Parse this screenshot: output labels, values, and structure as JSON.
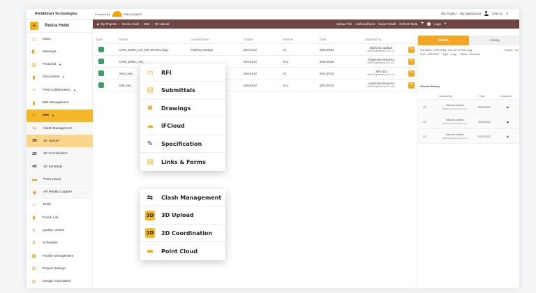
{
  "topbar": {
    "company": "iFieldSmart Technologies",
    "powered_by": "Powered By",
    "logo_text": "iFIELDSMART",
    "my_project": "My Project",
    "my_dashboard": "My Dashboard",
    "user": "John D."
  },
  "sidebar": {
    "project": "Revira Hotel",
    "items": [
      {
        "label": "Inbox",
        "icon": "inbox-icon"
      },
      {
        "label": "Meetings",
        "icon": "meetings-icon"
      },
      {
        "label": "Financial",
        "icon": "financial-icon",
        "dropdown": true
      },
      {
        "label": "Documents",
        "icon": "documents-icon",
        "dropdown": true
      },
      {
        "label": "Field Collaboration",
        "icon": "field-collaboration-icon",
        "dropdown": true
      },
      {
        "label": "BID Management",
        "icon": "bid-icon"
      },
      {
        "label": "BIM",
        "icon": "bim-icon",
        "dropdown": true
      },
      {
        "label": "Clash Management",
        "icon": "clash-icon"
      },
      {
        "label": "3D Upload",
        "icon": "3d-icon"
      },
      {
        "label": "2D Coordination",
        "icon": "2d-icon"
      },
      {
        "label": "4D Schedule",
        "icon": "4d-icon"
      },
      {
        "label": "Point Cloud",
        "icon": "point-cloud-icon"
      },
      {
        "label": "AR Reality Capture",
        "icon": "ar-icon"
      },
      {
        "label": "Tasks",
        "icon": "tasks-icon"
      },
      {
        "label": "Punch List",
        "icon": "punch-list-icon"
      },
      {
        "label": "Quality control",
        "icon": "quality-icon"
      },
      {
        "label": "Scheduler",
        "icon": "scheduler-icon"
      },
      {
        "label": "Facility Management",
        "icon": "facility-icon"
      },
      {
        "label": "Project Settings",
        "icon": "settings-icon"
      },
      {
        "label": "Design Automation",
        "icon": "automation-icon"
      }
    ]
  },
  "breadcrumb": {
    "items": [
      "My Projects",
      "Revira Hotel",
      "BIM",
      "3D Upload"
    ],
    "actions": [
      "Upload File",
      "Add level/area",
      "Export Clash",
      "Refresh Data",
      "Logs"
    ]
  },
  "table": {
    "headers": [
      "Type",
      "Name",
      "Levels/Areas",
      "Trades",
      "Version",
      "Date",
      "Updated by"
    ],
    "rows": [
      {
        "name": "UPM_BIMe_L04_DR SPOOL.dwg",
        "level": "Parking Garage",
        "trade": "Electrical",
        "version": "V1",
        "date": "8/01/2022",
        "by": "Mukund Jadhav",
        "co": "(BIM Engineering US LLC)"
      },
      {
        "name": "UPM_BIMe_L05_",
        "level": "",
        "trade": "Electrical",
        "version": "V12",
        "date": "8/01/2022",
        "by": "Anderson Stevens",
        "co": "(BIM Engineering US LLC)"
      },
      {
        "name": "WD1.nwc",
        "level": "",
        "trade": "Electrical",
        "version": "V1",
        "date": "8/01/2022",
        "by": "John Do",
        "co": "(BIM Engineering US LLC)"
      },
      {
        "name": "test.nwc",
        "level": "",
        "trade": "Electrical",
        "version": "V12",
        "date": "8/01/2022",
        "by": "Anderson Stevens",
        "co": "(BIM Engineering US LLC)"
      }
    ]
  },
  "details": {
    "tab_details": "Details",
    "tab_activity": "Activity",
    "file_name": "File Name : UPM_BIMe_L05_DR SPOOL.dwg",
    "version": "Version : V4",
    "date": "Date : 8/01/2022",
    "type": "Type : .Dwg",
    "status": "Status : Electrical",
    "history_title": "Version History",
    "history_headers": [
      "Updated By",
      "Date",
      "Download"
    ],
    "history": [
      {
        "v": "V3",
        "by": "Mukund Jadhav",
        "co": "(BIM Engineering US LLC)",
        "date": "02/01/2022"
      },
      {
        "v": "V2",
        "by": "Mukund Jadhav",
        "co": "(BIM Engineering US LLC)",
        "date": "02/01/2022"
      },
      {
        "v": "V1",
        "by": "Mukund Jadhav",
        "co": "(BIM Engineering US LLC)",
        "date": "02/01/2022"
      }
    ]
  },
  "menu1": {
    "items": [
      {
        "label": "RFI",
        "icon": "rfi-icon"
      },
      {
        "label": "Submittals",
        "icon": "submittals-icon"
      },
      {
        "label": "Drawings",
        "icon": "drawings-icon"
      },
      {
        "label": "iFCloud",
        "icon": "ifcloud-icon"
      },
      {
        "label": "Specification",
        "icon": "specification-icon"
      },
      {
        "label": "Links & Forms",
        "icon": "links-forms-icon"
      }
    ]
  },
  "menu2": {
    "items": [
      {
        "label": "Clash Management",
        "icon": "clash-icon"
      },
      {
        "label": "3D Upload",
        "icon": "3d-icon"
      },
      {
        "label": "2D Coordination",
        "icon": "2d-icon"
      },
      {
        "label": "Point Cloud",
        "icon": "point-cloud-icon"
      }
    ]
  },
  "colors": {
    "accent": "#f5a623",
    "breadcrumb_bg": "#6d4543",
    "bim_highlight": "#f5b629"
  }
}
